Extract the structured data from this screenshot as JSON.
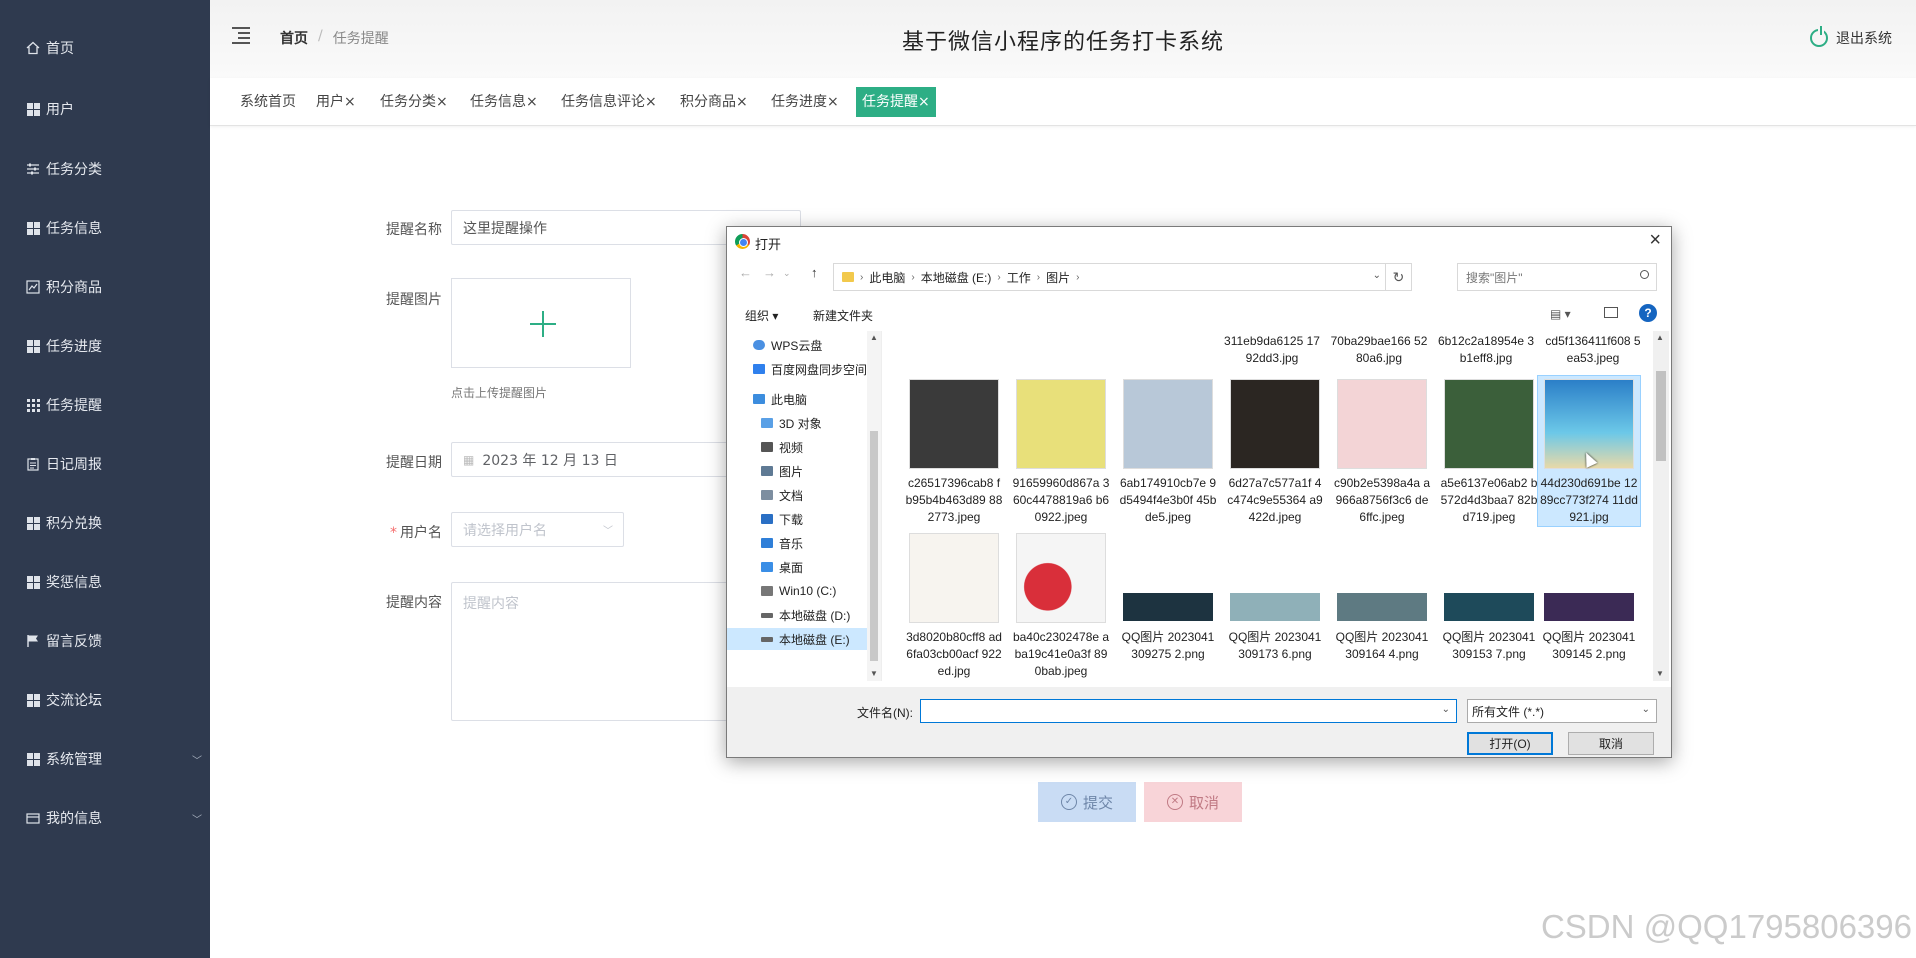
{
  "app_title": "基于微信小程序的任务打卡系统",
  "logout_label": "退出系统",
  "breadcrumb": {
    "home": "首页",
    "separator": "/",
    "current": "任务提醒"
  },
  "sidebar": {
    "items": [
      {
        "label": "首页",
        "icon": "home-icon"
      },
      {
        "label": "用户",
        "icon": "grid-icon"
      },
      {
        "label": "任务分类",
        "icon": "sliders-icon"
      },
      {
        "label": "任务信息",
        "icon": "grid-icon"
      },
      {
        "label": "积分商品",
        "icon": "chart-icon"
      },
      {
        "label": "任务进度",
        "icon": "grid-icon"
      },
      {
        "label": "任务提醒",
        "icon": "apps-icon"
      },
      {
        "label": "日记周报",
        "icon": "clipboard-icon"
      },
      {
        "label": "积分兑换",
        "icon": "grid-icon"
      },
      {
        "label": "奖惩信息",
        "icon": "grid-icon"
      },
      {
        "label": "留言反馈",
        "icon": "flag-icon"
      },
      {
        "label": "交流论坛",
        "icon": "grid-icon"
      },
      {
        "label": "系统管理",
        "icon": "grid-icon",
        "expandable": true
      },
      {
        "label": "我的信息",
        "icon": "card-icon",
        "expandable": true
      }
    ]
  },
  "tabs": [
    {
      "label": "系统首页",
      "closable": false
    },
    {
      "label": "用户",
      "closable": true
    },
    {
      "label": "任务分类",
      "closable": true
    },
    {
      "label": "任务信息",
      "closable": true
    },
    {
      "label": "任务信息评论",
      "closable": true
    },
    {
      "label": "积分商品",
      "closable": true
    },
    {
      "label": "任务进度",
      "closable": true
    },
    {
      "label": "任务提醒",
      "closable": true,
      "active": true
    }
  ],
  "form": {
    "name_label": "提醒名称",
    "name_value": "这里提醒操作",
    "image_label": "提醒图片",
    "image_hint": "点击上传提醒图片",
    "date_label": "提醒日期",
    "date_value": "2023 年 12 月 13 日",
    "user_label": "用户名",
    "user_required": "*",
    "user_placeholder": "请选择用户名",
    "content_label": "提醒内容",
    "content_placeholder": "提醒内容",
    "submit_label": "提交",
    "cancel_label": "取消"
  },
  "dialog": {
    "title": "打开",
    "address": [
      "此电脑",
      "本地磁盘 (E:)",
      "工作",
      "图片"
    ],
    "search_placeholder": "搜索\"图片\"",
    "organize_label": "组织 ▾",
    "new_folder_label": "新建文件夹",
    "tree": [
      {
        "label": "WPS云盘",
        "color": "#4a90e2"
      },
      {
        "label": "百度网盘同步空间",
        "color": "#2f80ed"
      },
      {
        "label": "此电脑",
        "color": "#3c8dde"
      },
      {
        "label": "3D 对象",
        "color": "#5aa0e6"
      },
      {
        "label": "视频",
        "color": "#555555"
      },
      {
        "label": "图片",
        "color": "#5f7a94"
      },
      {
        "label": "文档",
        "color": "#7d8ea0"
      },
      {
        "label": "下载",
        "color": "#2a6fc4"
      },
      {
        "label": "音乐",
        "color": "#2f7fd8"
      },
      {
        "label": "桌面",
        "color": "#3a8ee6"
      },
      {
        "label": "Win10 (C:)",
        "color": "#777777"
      },
      {
        "label": "本地磁盘 (D:)",
        "color": "#666666"
      },
      {
        "label": "本地磁盘 (E:)",
        "color": "#666666",
        "selected": true
      }
    ],
    "files_top": [
      {
        "name": "311eb9da6125 1792dd3.jpg"
      },
      {
        "name": "70ba29bae166 5280a6.jpg"
      },
      {
        "name": "6b12c2a18954e 3b1eff8.jpg"
      },
      {
        "name": "cd5f136411f608 5ea53.jpeg"
      }
    ],
    "files_row1": [
      {
        "name": "c26517396cab8 fb95b4b463d89 882773.jpeg",
        "color": "#3a3a3a"
      },
      {
        "name": "91659960d867a 360c4478819a6 b60922.jpeg",
        "color": "#e8e07a"
      },
      {
        "name": "6ab174910cb7e 9d5494f4e3b0f 45bde5.jpeg",
        "color": "#b8c8d8"
      },
      {
        "name": "6d27a7c577a1f 4c474c9e55364 a9422d.jpeg",
        "color": "#2b2622"
      },
      {
        "name": "c90b2e5398a4a a966a8756f3c6 de6ffc.jpeg",
        "color": "#f3d4d6"
      },
      {
        "name": "a5e6137e06ab2 b572d4d3baa7 82bd719.jpeg",
        "color": "#3b5f3a"
      },
      {
        "name": "44d230d691be 1289cc773f274 11dd921.jpg",
        "color": "#4aa6d8",
        "selected": true
      }
    ],
    "files_row2": [
      {
        "name": "3d8020b80cff8 ad6fa03cb00acf 922ed.jpg",
        "color": "#f7f4ef"
      },
      {
        "name": "ba40c2302478e aba19c41e0a3f 890bab.jpeg",
        "color": "#d92f3a"
      },
      {
        "name": "QQ图片 2023041309275 2.png",
        "color": "#1d3340"
      },
      {
        "name": "QQ图片 2023041309173 6.png",
        "color": "#8fb0b8"
      },
      {
        "name": "QQ图片 2023041309164 4.png",
        "color": "#5e7a82"
      },
      {
        "name": "QQ图片 2023041309153 7.png",
        "color": "#1e4a5a"
      },
      {
        "name": "QQ图片 2023041309145 2.png",
        "color": "#3b2a55"
      }
    ],
    "filename_label": "文件名(N):",
    "filename_value": "",
    "filetype_value": "所有文件 (*.*)",
    "open_label": "打开(O)",
    "cancel_label": "取消"
  },
  "watermark": "CSDN @QQ1795806396",
  "accent_color": "#2dae85",
  "sidebar_color": "#2f3a4f"
}
